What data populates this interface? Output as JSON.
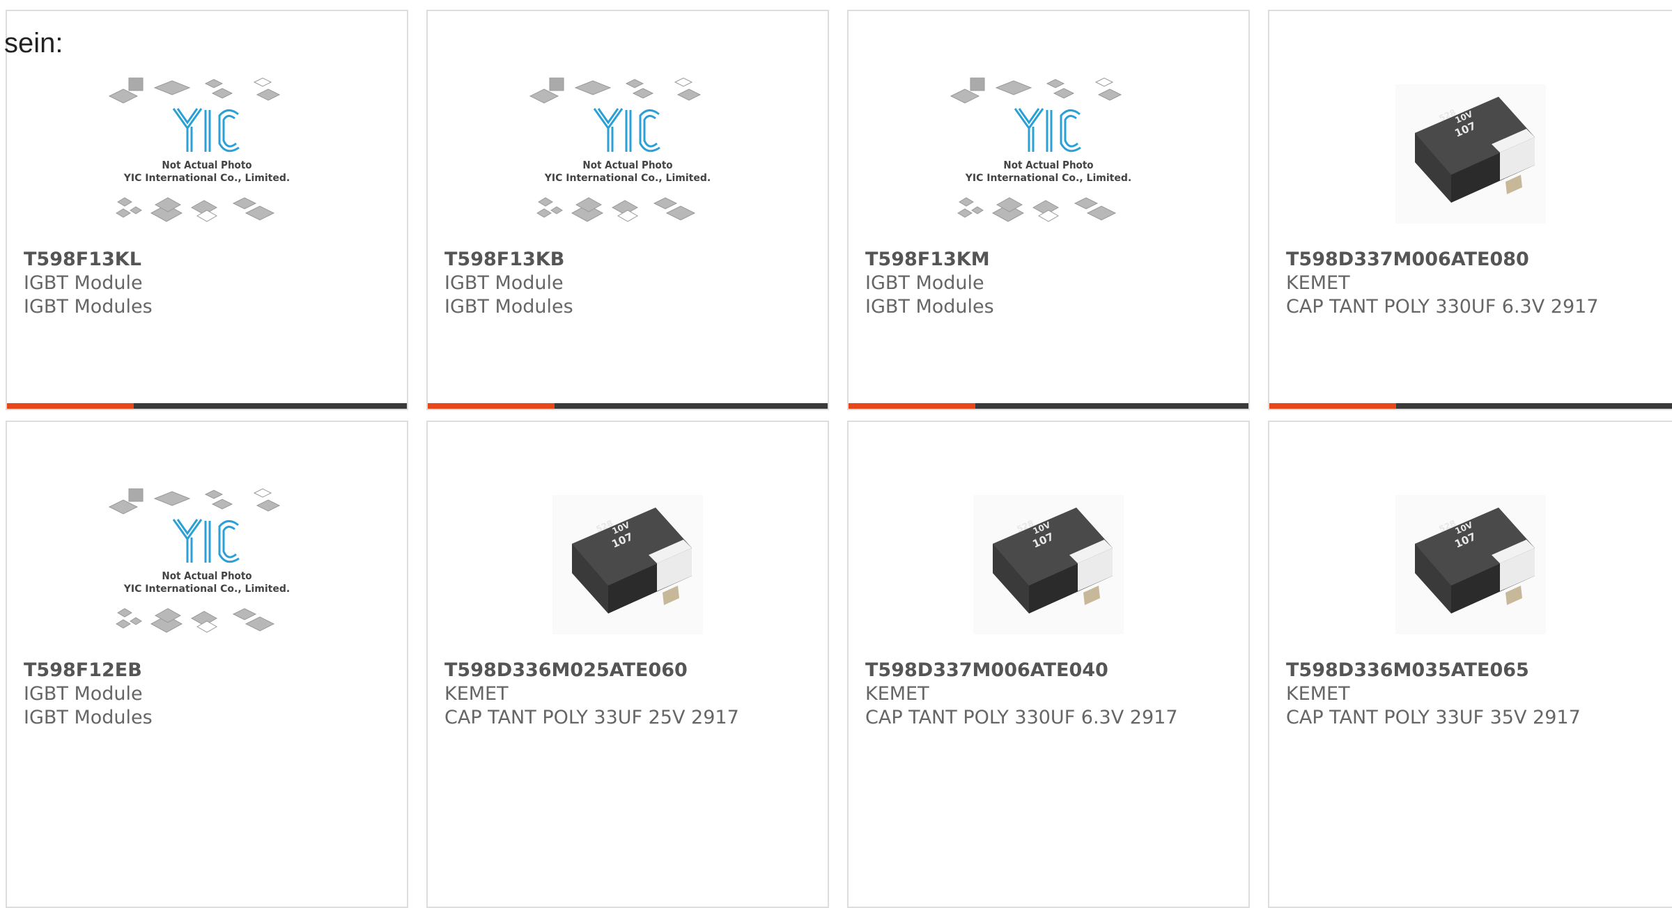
{
  "intro_text": "sein:",
  "placeholder": {
    "line1": "Not Actual Photo",
    "line2": "YIC International Co., Limited.",
    "logo": "YIC"
  },
  "products": [
    {
      "part": "T598F13KL",
      "maker": "IGBT Module",
      "desc": "IGBT Modules",
      "image": "placeholder"
    },
    {
      "part": "T598F13KB",
      "maker": "IGBT Module",
      "desc": "IGBT Modules",
      "image": "placeholder"
    },
    {
      "part": "T598F13KM",
      "maker": "IGBT Module",
      "desc": "IGBT Modules",
      "image": "placeholder"
    },
    {
      "part": "T598D337M006ATE080",
      "maker": "KEMET",
      "desc": "CAP TANT POLY 330UF 6.3V 2917",
      "image": "capacitor"
    },
    {
      "part": "T598F12EB",
      "maker": "IGBT Module",
      "desc": "IGBT Modules",
      "image": "placeholder"
    },
    {
      "part": "T598D336M025ATE060",
      "maker": "KEMET",
      "desc": "CAP TANT POLY 33UF 25V 2917",
      "image": "capacitor"
    },
    {
      "part": "T598D337M006ATE040",
      "maker": "KEMET",
      "desc": "CAP TANT POLY 330UF 6.3V 2917",
      "image": "capacitor"
    },
    {
      "part": "T598D336M035ATE065",
      "maker": "KEMET",
      "desc": "CAP TANT POLY 33UF 35V 2917",
      "image": "capacitor"
    }
  ],
  "capacitor_marking": {
    "top": "107",
    "mid": "10V",
    "bottom": "528"
  },
  "colors": {
    "accent": "#e8471a",
    "bar": "#3a3a3a",
    "logo_blue": "#2aa0d6",
    "border": "#dddddd"
  }
}
